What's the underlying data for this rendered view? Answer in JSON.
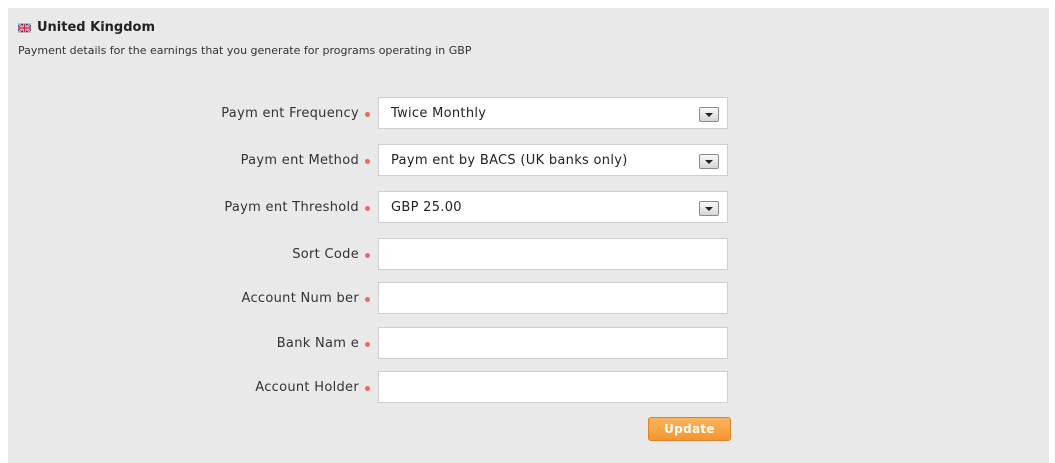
{
  "header": {
    "country": "United Kingdom",
    "description": "Payment details for the earnings that you generate for programs operating in GBP",
    "flag_icon": "uk-flag-icon"
  },
  "form": {
    "payment_frequency": {
      "label": "Paym ent Frequency",
      "value": "Twice Monthly"
    },
    "payment_method": {
      "label": "Paym ent Method",
      "value": "Paym ent by BACS (UK banks only)"
    },
    "payment_threshold": {
      "label": "Paym ent Threshold",
      "value": "GBP 25.00"
    },
    "sort_code": {
      "label": "Sort Code",
      "value": ""
    },
    "account_number": {
      "label": "Account Num ber",
      "value": ""
    },
    "bank_name": {
      "label": "Bank Nam e",
      "value": ""
    },
    "account_holder": {
      "label": "Account Holder",
      "value": ""
    }
  },
  "update_button": {
    "label": "Update"
  },
  "colors": {
    "panel_bg": "#e9e9e9",
    "required_dot": "#ee6666",
    "button_orange": "#f3962f"
  }
}
